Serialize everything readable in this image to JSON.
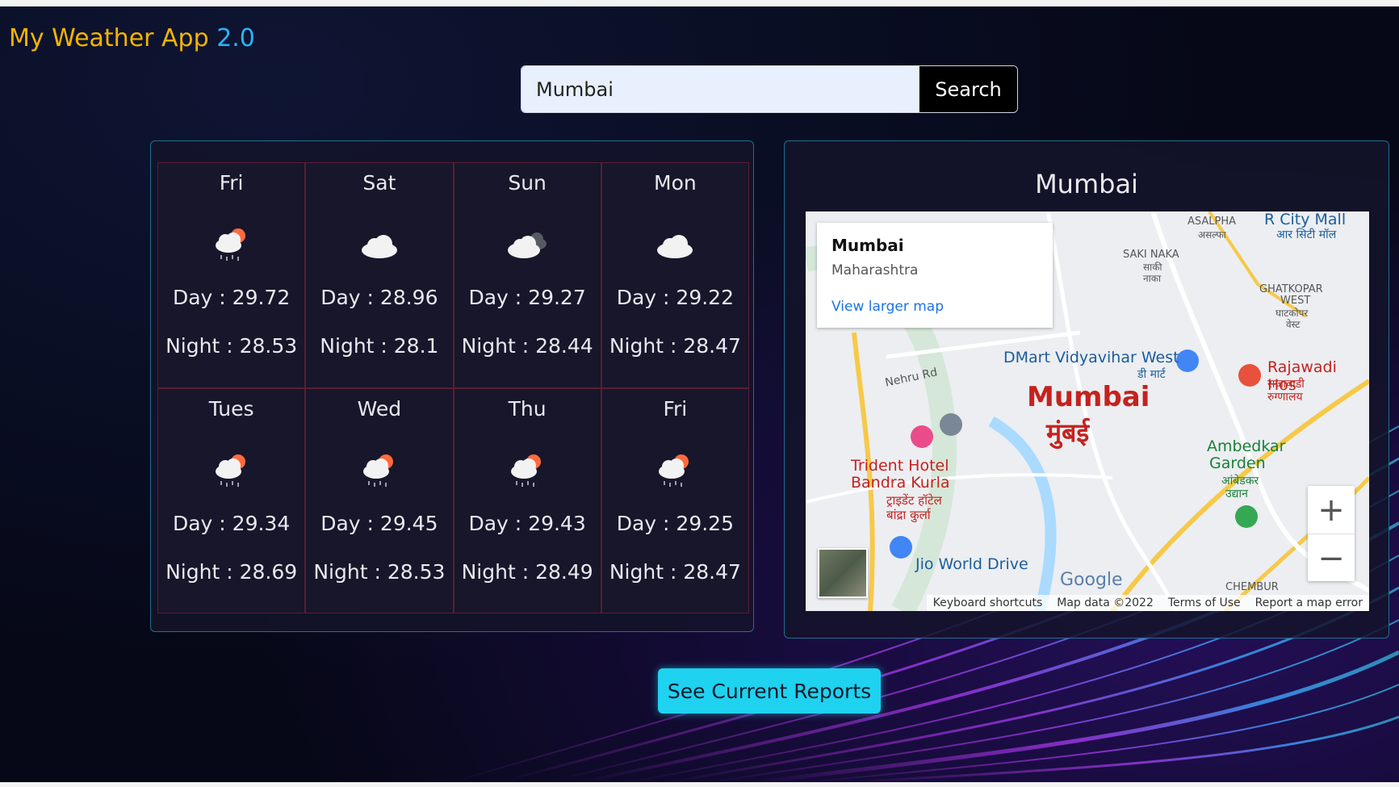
{
  "header": {
    "title": "My Weather App",
    "version": "2.0"
  },
  "search": {
    "value": "Mumbai",
    "button_label": "Search"
  },
  "forecast": [
    {
      "day": "Fri",
      "icon": "cloud-rain-sun-icon",
      "day_temp": "Day : 29.72",
      "night_temp": "Night : 28.53"
    },
    {
      "day": "Sat",
      "icon": "cloud-icon",
      "day_temp": "Day : 28.96",
      "night_temp": "Night : 28.1"
    },
    {
      "day": "Sun",
      "icon": "clouds-icon",
      "day_temp": "Day : 29.27",
      "night_temp": "Night : 28.44"
    },
    {
      "day": "Mon",
      "icon": "cloud-icon",
      "day_temp": "Day : 29.22",
      "night_temp": "Night : 28.47"
    },
    {
      "day": "Tues",
      "icon": "cloud-rain-sun-icon",
      "day_temp": "Day : 29.34",
      "night_temp": "Night : 28.69"
    },
    {
      "day": "Wed",
      "icon": "cloud-rain-sun-icon",
      "day_temp": "Day : 29.45",
      "night_temp": "Night : 28.53"
    },
    {
      "day": "Thu",
      "icon": "cloud-rain-sun-icon",
      "day_temp": "Day : 29.43",
      "night_temp": "Night : 28.49"
    },
    {
      "day": "Fri",
      "icon": "cloud-rain-sun-icon",
      "day_temp": "Day : 29.25",
      "night_temp": "Night : 28.47"
    }
  ],
  "map": {
    "title": "Mumbai",
    "card": {
      "name": "Mumbai",
      "region": "Maharashtra",
      "link": "View larger map"
    },
    "labels": {
      "city_en": "Mumbai",
      "city_hi": "मुंबई",
      "dmart": "DMart Vidyavihar West",
      "dmart_hi": "डी मार्ट",
      "rajawadi": "Rajawadi Hos",
      "rajawadi_hi": "राजावाडी",
      "rajawadi_hi2": "रुग्णालय",
      "ambedkar": "Ambedkar",
      "garden": "Garden",
      "ambedkar_hi": "आंबेडकर",
      "udyan_hi": "उद्यान",
      "trident1": "Trident Hotel",
      "trident2": "Bandra Kurla",
      "trident_hi1": "ट्राइडेंट हॉटेल",
      "trident_hi2": "बांद्रा कुर्ला",
      "jio": "Jio World Drive",
      "rcity": "R City Mall",
      "rcity_hi": "आर सिटी मॉल",
      "asalpha": "ASALPHA",
      "asalpha_hi": "असल्फा",
      "sakinaka": "SAKI NAKA",
      "sakinaka_hi": "साकी",
      "sakinaka_hi2": "नाका",
      "ghatkopar": "GHATKOPAR",
      "ghatkopar2": "WEST",
      "ghatkopar_hi": "घाटकोपर",
      "ghatkopar_hi2": "वेस्ट",
      "chembur": "CHEMBUR",
      "nehru": "Nehru Rd"
    },
    "google": "Google",
    "attribution": [
      "Keyboard shortcuts",
      "Map data ©2022",
      "Terms of Use",
      "Report a map error"
    ],
    "zoom_in": "+",
    "zoom_out": "−"
  },
  "cta": {
    "label": "See Current Reports"
  },
  "colors": {
    "title": "#f4b400",
    "version": "#25b6ff",
    "cta": "#1ed2f0",
    "city": "#c5221f"
  }
}
